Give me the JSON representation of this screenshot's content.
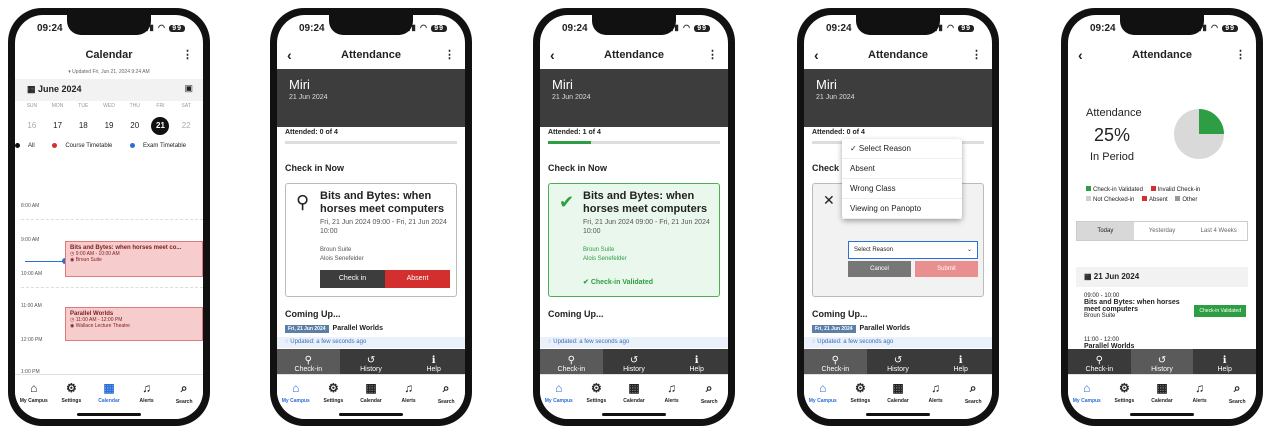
{
  "status_time": "09:24",
  "battery": "99",
  "tabbar": [
    "My Campus",
    "Settings",
    "Calendar",
    "Alerts",
    "Search"
  ],
  "calendar": {
    "title": "Calendar",
    "updated": "Updated Fri, Jun 21, 2024 9:24 AM",
    "month": "June 2024",
    "weekdays": [
      "SUN",
      "MON",
      "TUE",
      "WED",
      "THU",
      "FRI",
      "SAT"
    ],
    "days": [
      "16",
      "17",
      "18",
      "19",
      "20",
      "21",
      "22"
    ],
    "filters": [
      "All",
      "Course Timetable",
      "Exam Timetable"
    ],
    "times": [
      "8:00 AM",
      "9:00 AM",
      "10:00 AM",
      "11:00 AM",
      "12:00 PM",
      "1:00 PM"
    ],
    "events": [
      {
        "title": "Bits and Bytes: when horses meet co...",
        "time": "9:00 AM - 10:00 AM",
        "place": "Broun Suite"
      },
      {
        "title": "Parallel Worlds",
        "time": "11:00 AM - 12:00 PM",
        "place": "Wallace Lecture Theatre"
      }
    ]
  },
  "attendance": {
    "title": "Attendance",
    "class_name": "Miri",
    "date": "21 Jun 2024",
    "attended_0": "Attended: 0 of 4",
    "attended_1": "Attended: 1 of 4",
    "check_in_now": "Check in Now",
    "card_title": "Bits and Bytes: when horses meet computers",
    "card_time": "Fri, 21 Jun 2024 09:00 - Fri, 21 Jun 2024 10:00",
    "room": "Broun Suite",
    "lecturer": "Alois Senefelder",
    "checkin_btn": "Check in",
    "absent_btn": "Absent",
    "validated": "Check-in Validated",
    "coming_up": "Coming Up...",
    "coming_chip": "Fri, 21 Jun 2024",
    "coming_title": "Parallel Worlds",
    "updated": "Updated: a few seconds ago",
    "subtabs": [
      "Check-in",
      "History",
      "Help"
    ]
  },
  "dropdown": {
    "options": [
      "✓ Select Reason",
      "Absent",
      "Wrong Class",
      "Viewing on Panopto"
    ],
    "select_placeholder": "Select Reason",
    "cancel": "Cancel",
    "submit": "Submit"
  },
  "stats": {
    "heading": "Attendance",
    "percent": "25%",
    "sub": "In Period",
    "legend": [
      "Check-in Validated",
      "Invalid Check-in",
      "Not Checked-in",
      "Absent",
      "Other"
    ],
    "ranges": [
      "Today",
      "Yesterday",
      "Last 4 Weeks"
    ],
    "day": "21 Jun 2024",
    "item1_time": "09:00 - 10:00",
    "item1_title": "Bits and Bytes: when horses meet computers",
    "item1_place": "Broun Suite",
    "item1_badge": "Check-in Validated",
    "item2_time": "11:00 - 12:00",
    "item2_title": "Parallel Worlds"
  },
  "colors": {
    "accent": "#2a6fd6",
    "green": "#2e9e44",
    "red": "#d32f2f",
    "dark": "#3d3d3d"
  }
}
